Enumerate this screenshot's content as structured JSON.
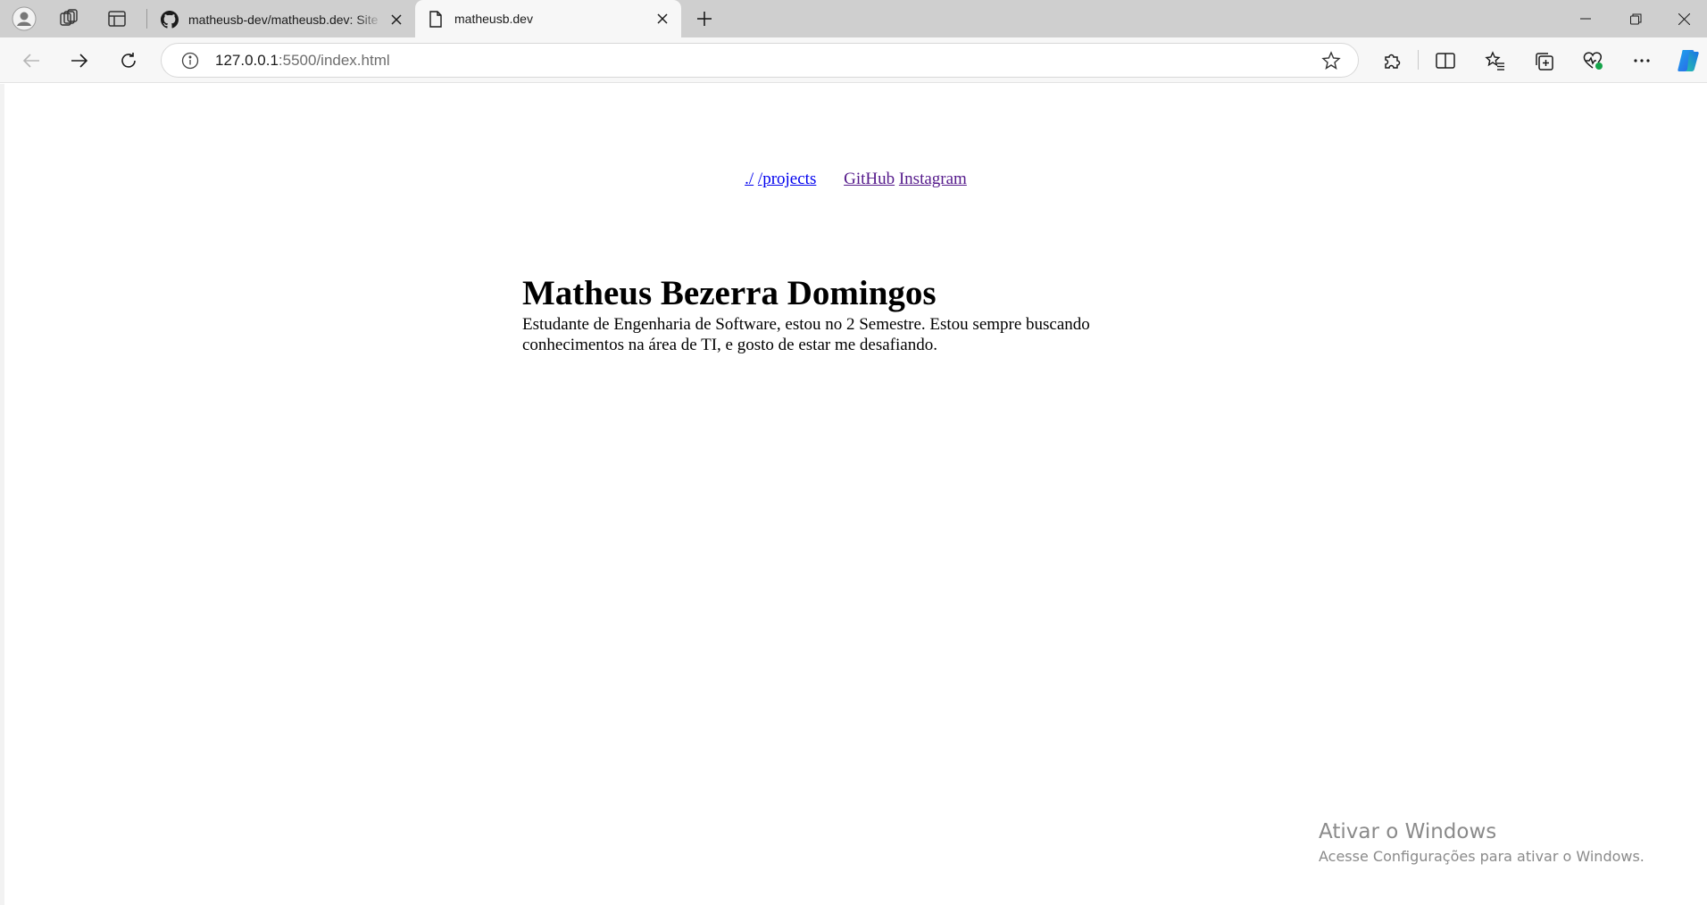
{
  "browser": {
    "tabs": [
      {
        "title": "matheusb-dev/matheusb.dev: Site",
        "favicon": "github-icon",
        "active": false
      },
      {
        "title": "matheusb.dev",
        "favicon": "document-icon",
        "active": true
      }
    ],
    "address": {
      "host": "127.0.0.1",
      "rest": ":5500/index.html"
    },
    "accent": "#1a73e8"
  },
  "page": {
    "nav": {
      "home": "./",
      "projects": "/projects",
      "github": "GitHub",
      "instagram": "Instagram"
    },
    "heading": "Matheus Bezerra Domingos",
    "bio_line1": "Estudante de Engenharia de Software, estou no 2 Semestre. Estou sempre buscando",
    "bio_line2": "conhecimentos na área de TI, e gosto de estar me desafiando."
  },
  "watermark": {
    "title": "Ativar o Windows",
    "subtitle": "Acesse Configurações para ativar o Windows."
  }
}
